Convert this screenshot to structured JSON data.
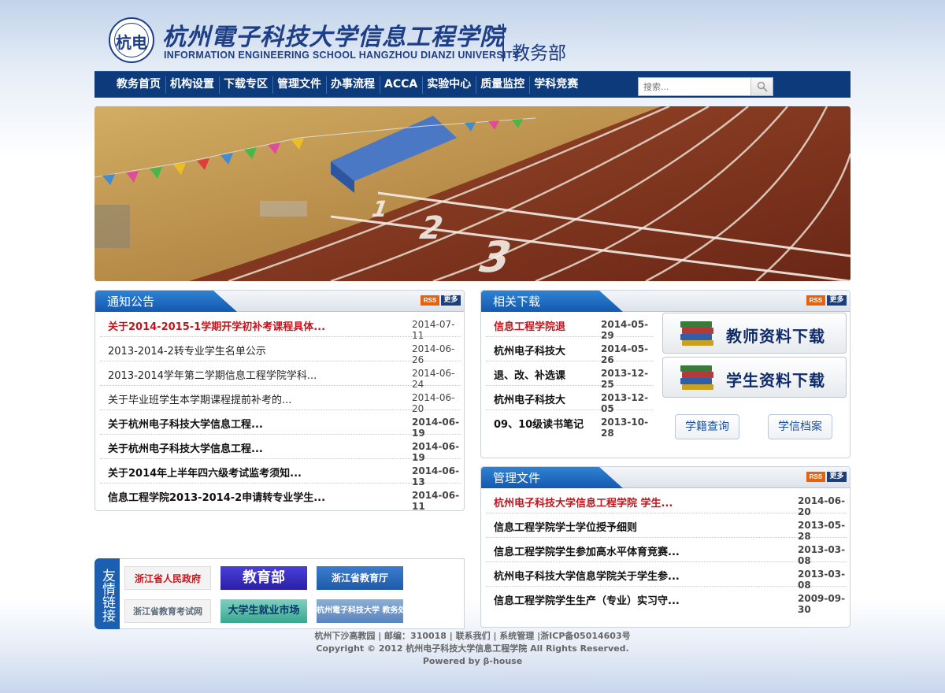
{
  "header": {
    "seal_glyph": "杭电",
    "school_cn": "杭州電子科技大学信息工程学院",
    "school_en": "INFORMATION ENGINEERING SCHOOL HANGZHOU DIANZI UNIVERSITY",
    "dept": "教务部"
  },
  "nav": {
    "items": [
      "教务首页",
      "机构设置",
      "下载专区",
      "管理文件",
      "办事流程",
      "ACCA",
      "实验中心",
      "质量监控",
      "学科竞赛"
    ],
    "search_placeholder": "搜索..."
  },
  "notices": {
    "title": "通知公告",
    "rss": "RSS",
    "more": "更多",
    "items": [
      {
        "title": "关于2014-2015-1学期开学初补考课程具体...",
        "date": "2014-07-11"
      },
      {
        "title": "2013-2014-2转专业学生名单公示",
        "date": "2014-06-26"
      },
      {
        "title": "2013-2014学年第二学期信息工程学院学科...",
        "date": "2014-06-24"
      },
      {
        "title": "关于毕业班学生本学期课程提前补考的...",
        "date": "2014-06-20"
      },
      {
        "title": "关于杭州电子科技大学信息工程...",
        "date": "2014-06-19"
      },
      {
        "title": "关于杭州电子科技大学信息工程...",
        "date": "2014-06-19"
      },
      {
        "title": "关于2014年上半年四六级考试监考须知...",
        "date": "2014-06-13"
      },
      {
        "title": "信息工程学院2013-2014-2申请转专业学生...",
        "date": "2014-06-11"
      }
    ]
  },
  "downloads": {
    "title": "相关下载",
    "rss": "RSS",
    "more": "更多",
    "items": [
      {
        "title": "信息工程学院退",
        "date": "2014-05-29"
      },
      {
        "title": "杭州电子科技大",
        "date": "2014-05-26"
      },
      {
        "title": "退、改、补选课",
        "date": "2013-12-25"
      },
      {
        "title": "杭州电子科技大",
        "date": "2013-12-05"
      },
      {
        "title": "09、10级读书笔记",
        "date": "2013-10-28"
      }
    ],
    "teacher_btn": "教师资料下载",
    "student_btn": "学生资料下载",
    "xueji": "学籍查询",
    "xuexin": "学信档案"
  },
  "docs": {
    "title": "管理文件",
    "rss": "RSS",
    "more": "更多",
    "items": [
      {
        "title": "杭州电子科技大学信息工程学院 学生...",
        "date": "2014-06-20"
      },
      {
        "title": "信息工程学院学士学位授予细则",
        "date": "2013-05-28"
      },
      {
        "title": "信息工程学院学生参加高水平体育竞赛...",
        "date": "2013-03-08"
      },
      {
        "title": "杭州电子科技大学信息学院关于学生参...",
        "date": "2013-03-08"
      },
      {
        "title": "信息工程学院学生生产（专业）实习守...",
        "date": "2009-09-30"
      }
    ]
  },
  "links": {
    "tab": "友情链接",
    "items": [
      "浙江省人民政府",
      "教育部",
      "浙江省教育厅",
      "浙江省教育考试网",
      "大学生就业市场",
      "杭州電子科技大学 教务处"
    ]
  },
  "footer": {
    "line1": "杭州下沙高教园 | 邮编：310018 | 联系我们 | 系统管理 |浙ICP备05014603号",
    "line2": "Copyright © 2012 杭州电子科技大学信息工程学院 All Rights Reserved.",
    "line3": "Powered by β-house"
  }
}
